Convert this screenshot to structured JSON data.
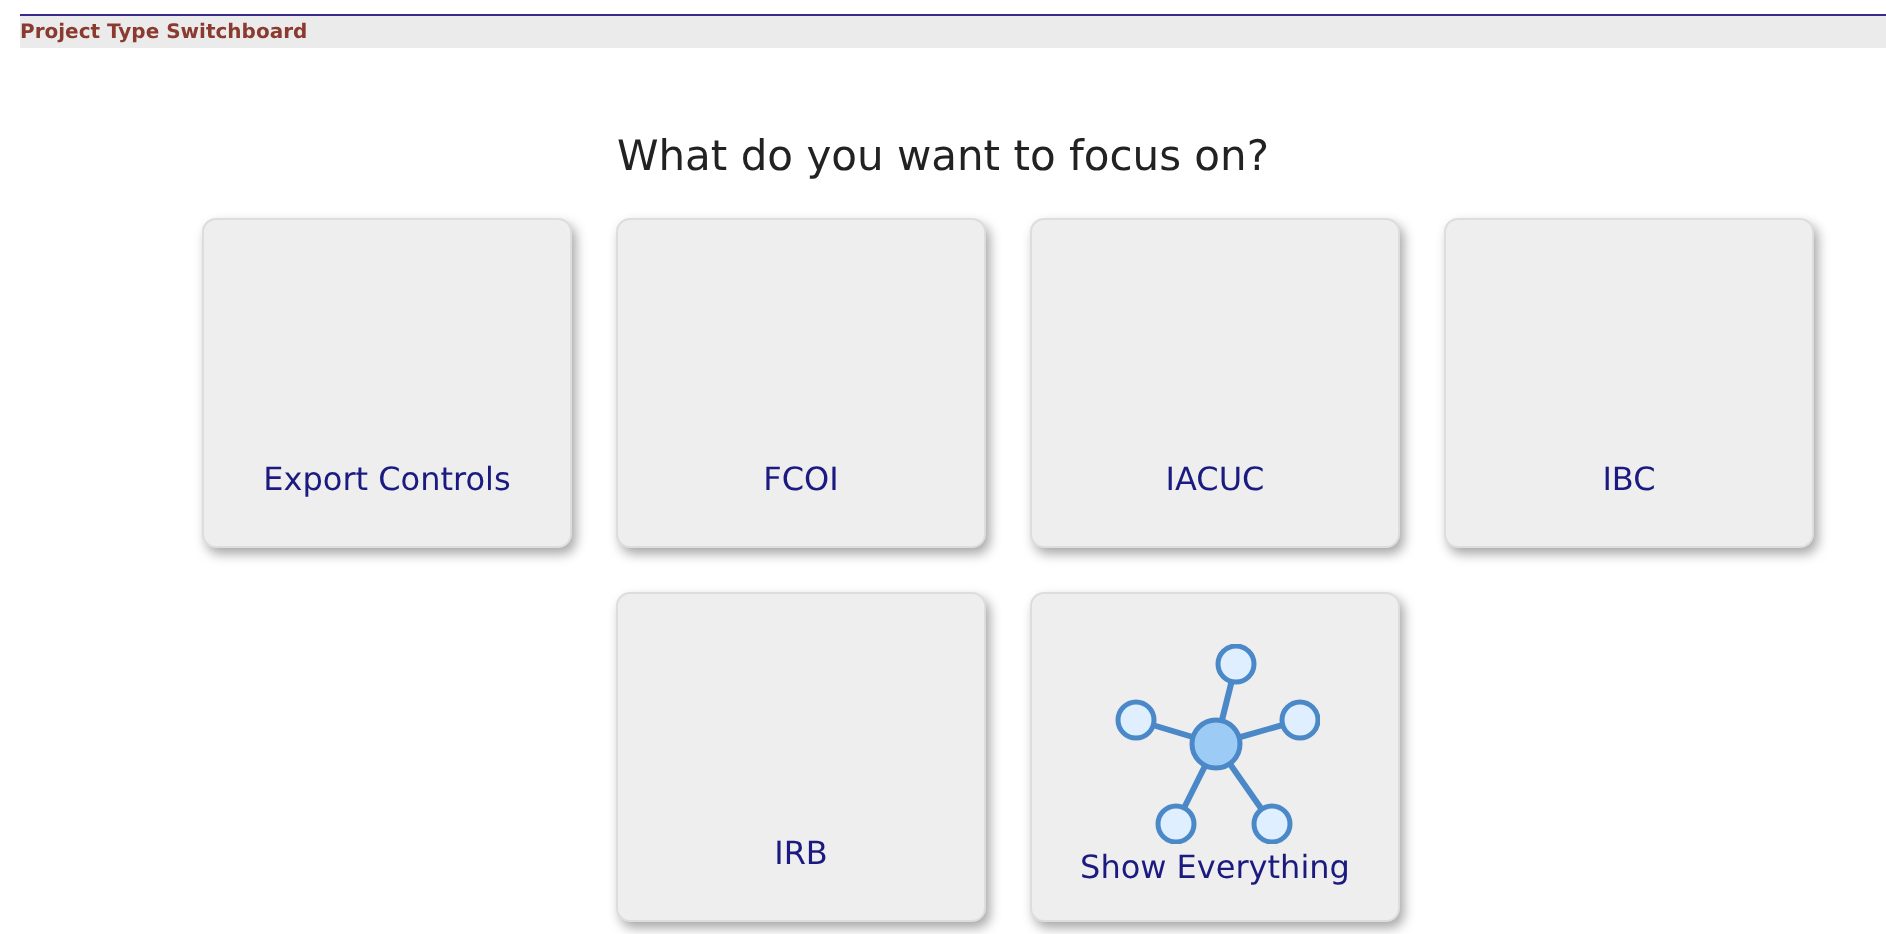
{
  "header": {
    "title": "Project Type Switchboard"
  },
  "heading": "What do you want to focus on?",
  "tiles": [
    {
      "label": "Export Controls",
      "kind": "plain"
    },
    {
      "label": "FCOI",
      "kind": "plain"
    },
    {
      "label": "IACUC",
      "kind": "plain"
    },
    {
      "label": "IBC",
      "kind": "plain"
    },
    {
      "label": "IRB",
      "kind": "plain"
    },
    {
      "label": "Show Everything",
      "kind": "network"
    }
  ]
}
